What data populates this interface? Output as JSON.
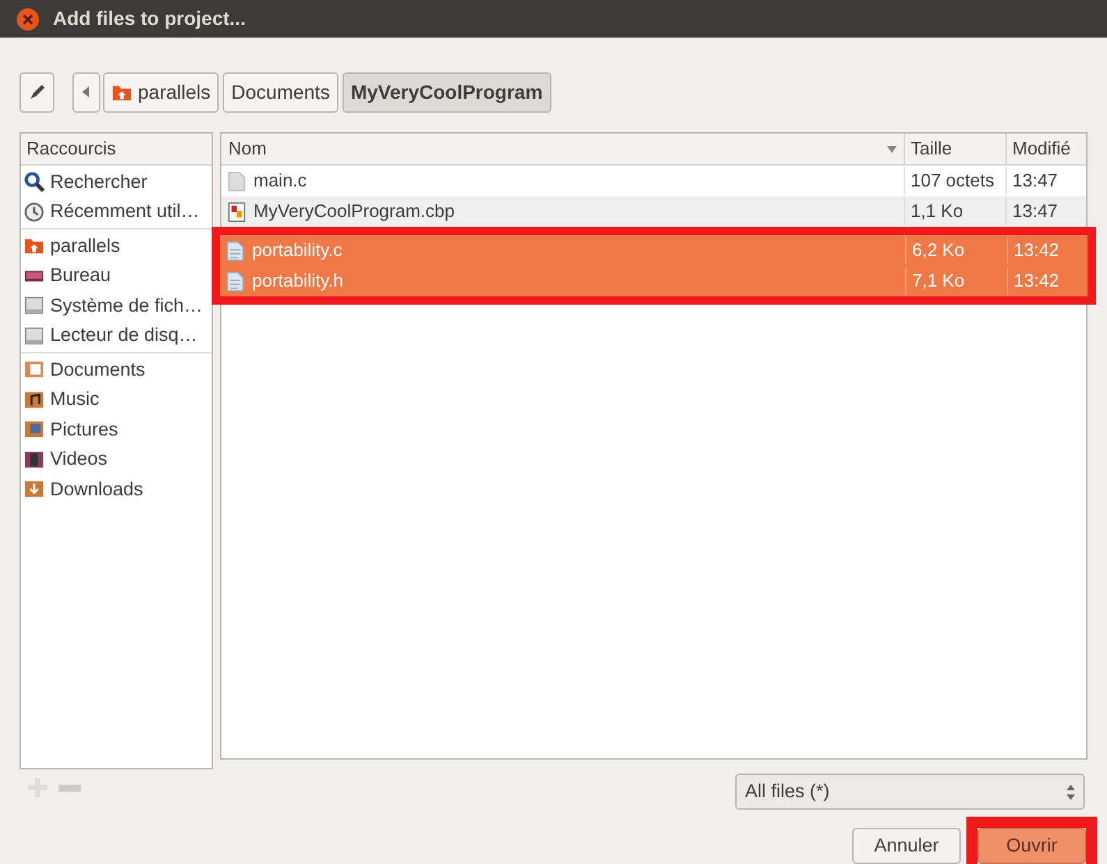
{
  "window": {
    "title": "Add files to project..."
  },
  "path_bar": [
    {
      "label": "parallels",
      "kind": "home",
      "selected": false
    },
    {
      "label": "Documents",
      "kind": "plain",
      "selected": false
    },
    {
      "label": "MyVeryCoolProgram",
      "kind": "plain",
      "selected": true
    }
  ],
  "sidebar": {
    "heading": "Raccourcis",
    "sections": [
      {
        "items": [
          {
            "label": "Rechercher",
            "kind": "search"
          },
          {
            "label": "Récemment util…",
            "kind": "recent"
          }
        ]
      },
      {
        "items": [
          {
            "label": "parallels",
            "kind": "home"
          },
          {
            "label": "Bureau",
            "kind": "desktop"
          },
          {
            "label": "Système de fich…",
            "kind": "drive"
          },
          {
            "label": "Lecteur de disq…",
            "kind": "drive"
          }
        ]
      },
      {
        "items": [
          {
            "label": "Documents",
            "kind": "documents"
          },
          {
            "label": "Music",
            "kind": "music"
          },
          {
            "label": "Pictures",
            "kind": "pictures"
          },
          {
            "label": "Videos",
            "kind": "videos"
          },
          {
            "label": "Downloads",
            "kind": "downloads"
          }
        ]
      }
    ]
  },
  "table": {
    "columns": [
      "Nom",
      "Taille",
      "Modifié"
    ],
    "rows": [
      {
        "name": "main.c",
        "size": "107 octets",
        "modified": "13:47",
        "kind": "text",
        "selected": false,
        "highlighted": false
      },
      {
        "name": "MyVeryCoolProgram.cbp",
        "size": "1,1 Ko",
        "modified": "13:47",
        "kind": "project",
        "selected": false,
        "highlighted": false
      },
      {
        "name": "portability.c",
        "size": "6,2 Ko",
        "modified": "13:42",
        "kind": "source",
        "selected": true,
        "highlighted": true
      },
      {
        "name": "portability.h",
        "size": "7,1 Ko",
        "modified": "13:42",
        "kind": "source",
        "selected": true,
        "highlighted": true
      }
    ]
  },
  "filter": {
    "value": "All files (*)"
  },
  "buttons": [
    {
      "label": "Annuler",
      "highlighted": false
    },
    {
      "label": "Ouvrir",
      "highlighted": true
    }
  ]
}
